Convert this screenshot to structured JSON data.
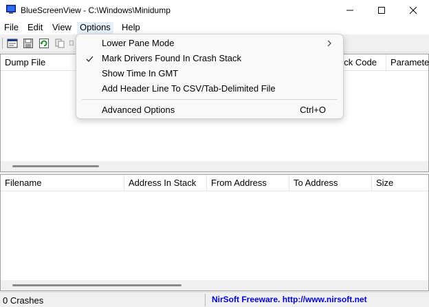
{
  "window": {
    "title": "BlueScreenView  -  C:\\Windows\\Minidump"
  },
  "menubar": {
    "items": [
      "File",
      "Edit",
      "View",
      "Options",
      "Help"
    ]
  },
  "options_menu": {
    "items": [
      {
        "label": "Lower Pane Mode",
        "checked": false,
        "submenu": true,
        "shortcut": ""
      },
      {
        "label": "Mark Drivers Found In Crash Stack",
        "checked": true,
        "submenu": false,
        "shortcut": ""
      },
      {
        "label": "Show Time In GMT",
        "checked": false,
        "submenu": false,
        "shortcut": ""
      },
      {
        "label": "Add Header Line To CSV/Tab-Delimited File",
        "checked": false,
        "submenu": false,
        "shortcut": ""
      },
      {
        "label": "Advanced Options",
        "checked": false,
        "submenu": false,
        "shortcut": "Ctrl+O"
      }
    ]
  },
  "top_pane": {
    "columns": [
      "Dump File",
      "eck Code",
      "Paramete"
    ]
  },
  "bottom_pane": {
    "columns": [
      "Filename",
      "Address In Stack",
      "From Address",
      "To Address",
      "Size"
    ]
  },
  "status": {
    "crashes": "0 Crashes",
    "credit": "NirSoft Freeware.  http://www.nirsoft.net"
  },
  "colors": {
    "credit_text": "#0000cc",
    "menu_highlight": "#e5f0fb"
  },
  "icons": [
    "bluescreen-app-icon",
    "properties-icon",
    "save-icon",
    "refresh-icon",
    "copy-icon",
    "submenu-arrow-icon",
    "checkmark-icon"
  ]
}
